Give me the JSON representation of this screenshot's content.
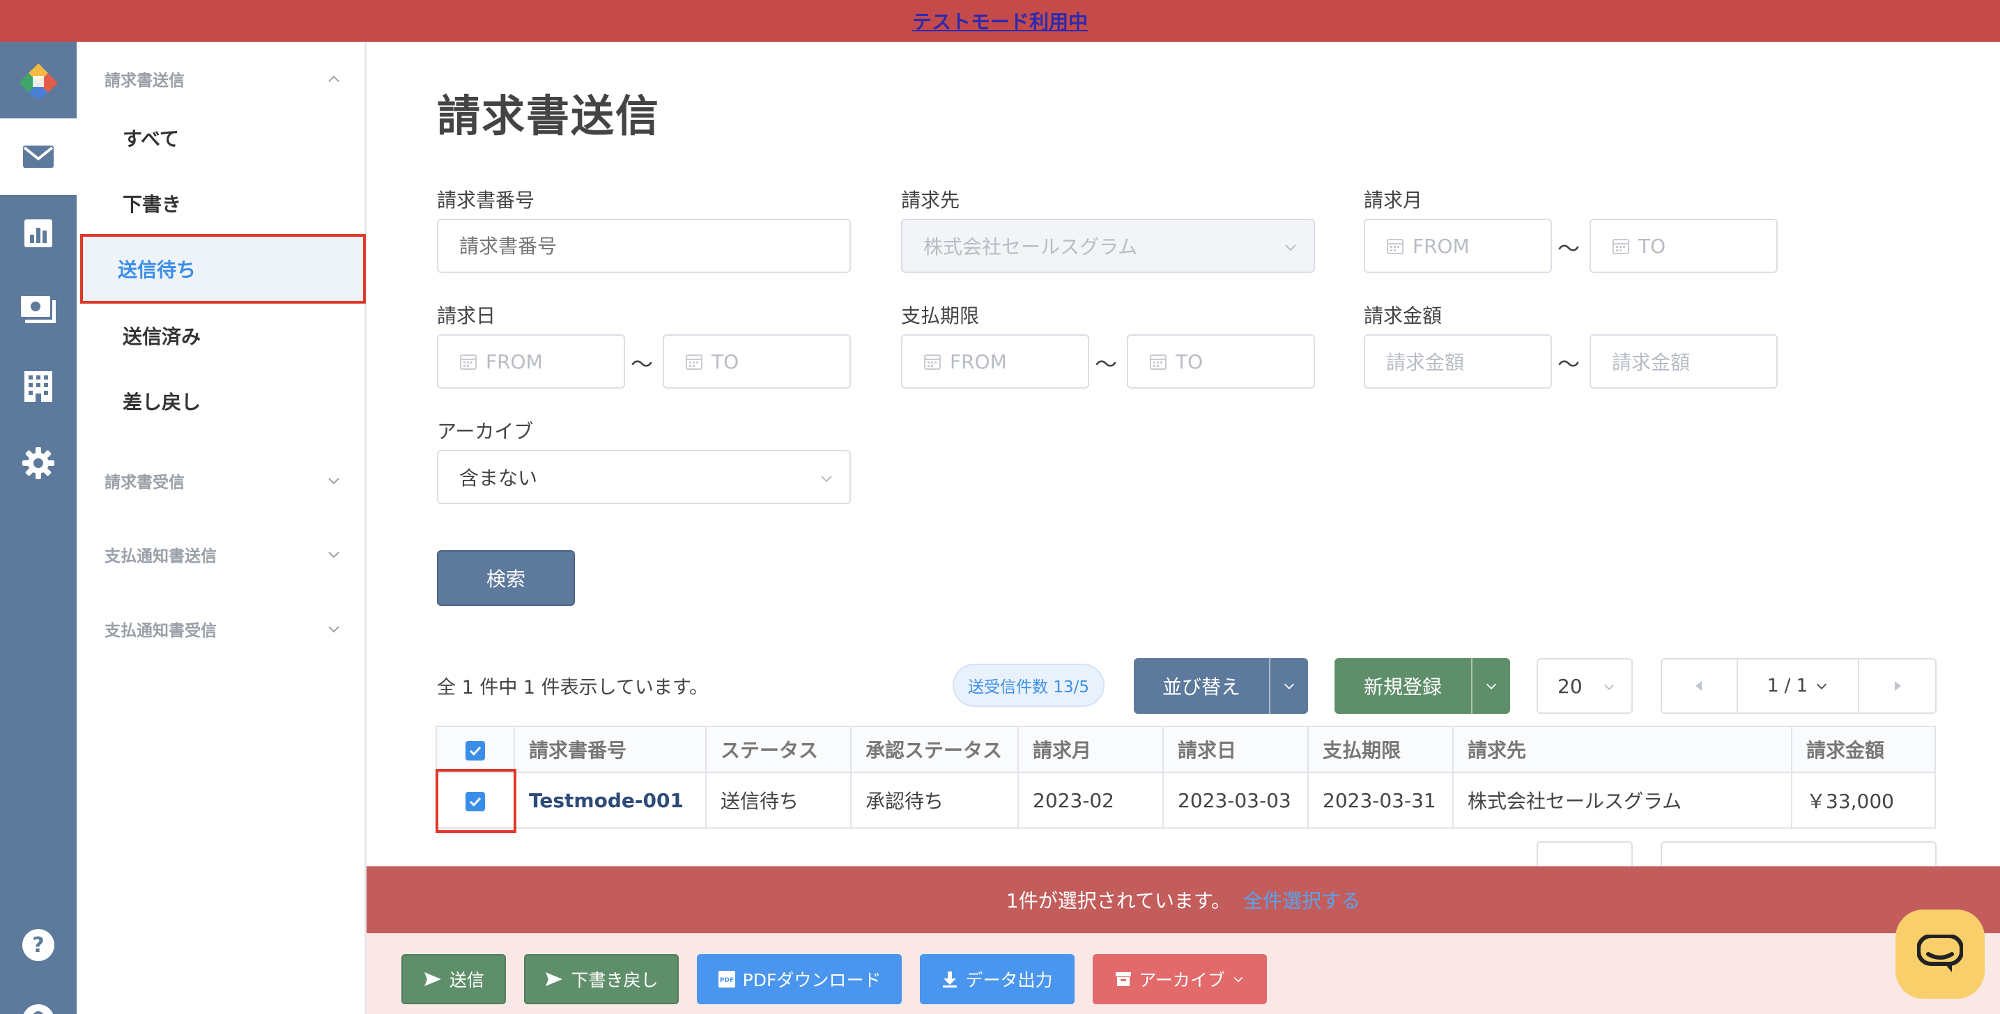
{
  "banner": {
    "text": "テストモード利用中"
  },
  "sidebar": {
    "groups": [
      {
        "label": "請求書送信"
      },
      {
        "label": "請求書受信"
      },
      {
        "label": "支払通知書送信"
      },
      {
        "label": "支払通知書受信"
      }
    ],
    "items": [
      {
        "label": "すべて"
      },
      {
        "label": "下書き"
      },
      {
        "label": "送信待ち"
      },
      {
        "label": "送信済み"
      },
      {
        "label": "差し戻し"
      }
    ]
  },
  "page": {
    "title": "請求書送信"
  },
  "filters": {
    "invoice_no": {
      "label": "請求書番号",
      "placeholder": "請求書番号"
    },
    "client": {
      "label": "請求先",
      "value": "株式会社セールスグラム"
    },
    "billing_month": {
      "label": "請求月",
      "from": "FROM",
      "to": "TO"
    },
    "invoice_date": {
      "label": "請求日",
      "from": "FROM",
      "to": "TO"
    },
    "due_date": {
      "label": "支払期限",
      "from": "FROM",
      "to": "TO"
    },
    "amount": {
      "label": "請求金額",
      "from": "請求金額",
      "to": "請求金額"
    },
    "archive": {
      "label": "アーカイブ",
      "value": "含まない"
    },
    "tilde": "〜",
    "search_label": "検索"
  },
  "list": {
    "count_text": "全 1 件中 1 件表示しています。",
    "quota": "送受信件数 13/5",
    "sort_label": "並び替え",
    "new_label": "新規登録",
    "page_size": "20",
    "page_indicator": "1 / 1"
  },
  "table": {
    "headers": [
      "請求書番号",
      "ステータス",
      "承認ステータス",
      "請求月",
      "請求日",
      "支払期限",
      "請求先",
      "請求金額"
    ],
    "rows": [
      [
        "Testmode-001",
        "送信待ち",
        "承認待ち",
        "2023-02",
        "2023-03-03",
        "2023-03-31",
        "株式会社セールスグラム",
        "￥33,000"
      ]
    ]
  },
  "selection": {
    "text": "1件が選択されています。",
    "select_all": "全件選択する"
  },
  "actions": {
    "send": "送信",
    "revert": "下書き戻し",
    "pdf": "PDFダウンロード",
    "export": "データ出力",
    "archive": "アーカイブ"
  },
  "colors": {
    "banner": "#c54b4b",
    "rail": "#5d7a9c",
    "accent_blue": "#3a8ee8",
    "green": "#5f8f6a",
    "danger": "#e26a6a",
    "selection_bar": "#c35d5b"
  },
  "icons": [
    "logo-icon",
    "mail-icon",
    "chart-icon",
    "payment-icon",
    "building-icon",
    "gear-icon",
    "help-icon",
    "user-icon",
    "calendar-icon",
    "chevron-down-icon",
    "chevron-up-icon",
    "chat-icon"
  ]
}
